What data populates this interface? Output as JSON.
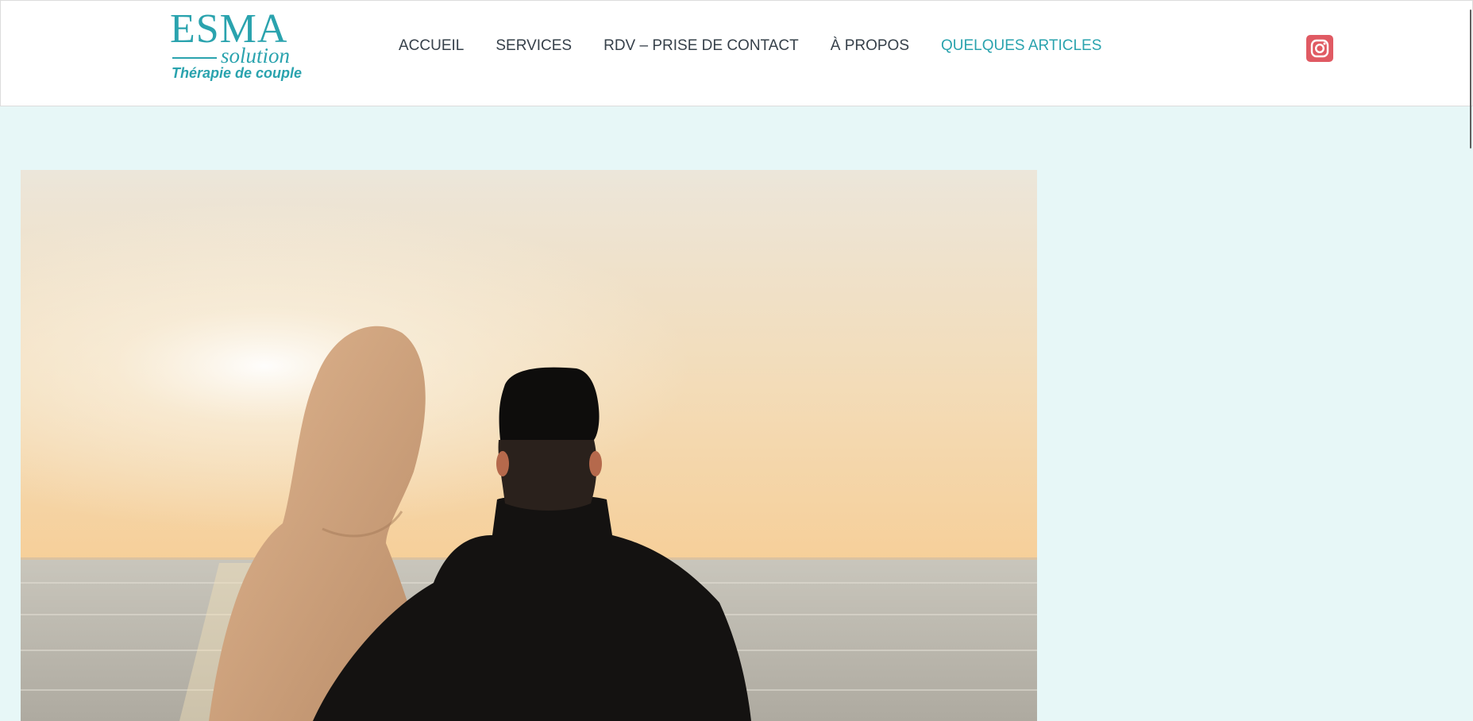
{
  "logo": {
    "main": "ESMA",
    "sub": "solution",
    "tagline": "Thérapie de couple"
  },
  "nav": {
    "items": [
      {
        "label": "ACCUEIL"
      },
      {
        "label": "SERVICES"
      },
      {
        "label": "RDV – PRISE DE CONTACT"
      },
      {
        "label": "À PROPOS"
      },
      {
        "label": "QUELQUES ARTICLES"
      }
    ],
    "active_index": 4
  },
  "social": {
    "icon": "instagram-icon"
  },
  "colors": {
    "brand": "#2aa3ae",
    "nav_text": "#36404a",
    "background": "#e7f7f7",
    "instagram": "#e05a63"
  }
}
